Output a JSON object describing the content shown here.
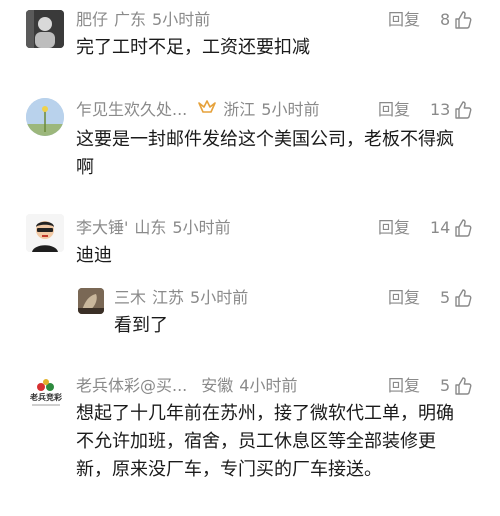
{
  "comments": [
    {
      "user": "肥仔",
      "location": "广东",
      "time": "5小时前",
      "reply_label": "回复",
      "likes": "8",
      "text": "完了工时不足，工资还要扣减"
    },
    {
      "user": "乍见生欢久处...",
      "badge_icon": "crown-badge-icon",
      "location": "浙江",
      "time": "5小时前",
      "reply_label": "回复",
      "likes": "13",
      "text_line1": "这要是一封邮件发给这个美国公司，老板不得疯",
      "text_line2": "啊"
    },
    {
      "user": "李大锤'",
      "location": "山东",
      "time": "5小时前",
      "reply_label": "回复",
      "likes": "14",
      "text": "迪迪",
      "reply": {
        "user": "三木",
        "location": "江苏",
        "time": "5小时前",
        "reply_label": "回复",
        "likes": "5",
        "text": "看到了"
      }
    },
    {
      "user": "老兵体彩@买...",
      "avatar_text": "老兵竞彩",
      "location": "安徽",
      "time": "4小时前",
      "reply_label": "回复",
      "likes": "5",
      "text_line1": "想起了十几年前在苏州，接了微软代工单，明确",
      "text_line2": "不允许加班，宿舍，员工休息区等全部装修更",
      "text_line3": "新，原来没厂车，专门买的厂车接送。"
    }
  ],
  "colors": {
    "meta": "#8a8a8a",
    "text": "#1a1a1a",
    "badge": "#e6a23c"
  }
}
